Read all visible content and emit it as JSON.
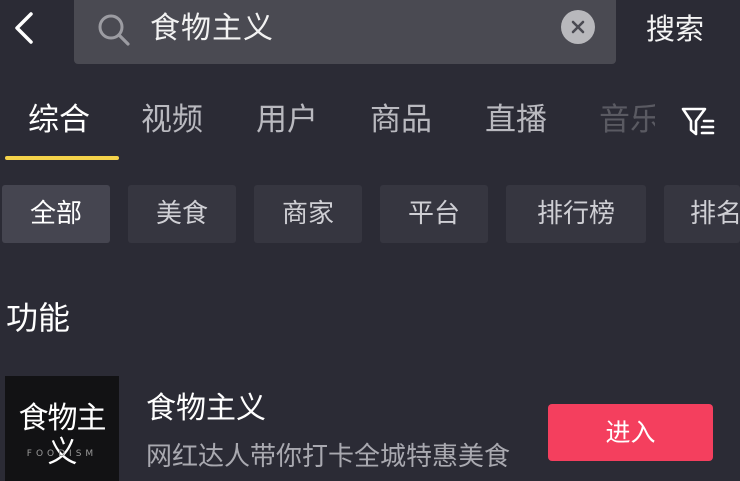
{
  "search": {
    "query": "食物主义",
    "submit_label": "搜索"
  },
  "tabs": [
    {
      "label": "综合"
    },
    {
      "label": "视频"
    },
    {
      "label": "用户"
    },
    {
      "label": "商品"
    },
    {
      "label": "直播"
    },
    {
      "label": "音乐"
    }
  ],
  "chips": [
    {
      "label": "全部"
    },
    {
      "label": "美食"
    },
    {
      "label": "商家"
    },
    {
      "label": "平台"
    },
    {
      "label": "排行榜"
    },
    {
      "label": "排名"
    }
  ],
  "section": {
    "title": "功能"
  },
  "result": {
    "logo_text": "食物主义",
    "logo_subtext": "FOODISM",
    "title": "食物主义",
    "description": "网红达人带你打卡全城特惠美食",
    "action_label": "进入"
  },
  "colors": {
    "background": "#2b2b35",
    "search_box": "#4a4a52",
    "tab_underline": "#f4d24a",
    "action_button": "#f43f5e"
  },
  "icons": {
    "back": "chevron-left-icon",
    "search": "search-icon",
    "clear": "close-icon",
    "filter": "filter-icon"
  }
}
